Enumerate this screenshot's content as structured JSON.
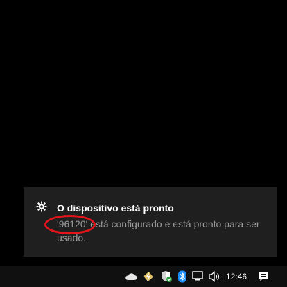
{
  "toast": {
    "icon": "gear-icon",
    "title": "O dispositivo está pronto",
    "body": "'96120' está configurado e está pronto para ser usado."
  },
  "annotation": {
    "shape": "ellipse",
    "color": "#e3141b",
    "target": "'96120'"
  },
  "taskbar": {
    "tray_icons": [
      "onedrive-cloud-icon",
      "power-battery-icon",
      "security-shield-icon",
      "bluetooth-icon",
      "network-icon",
      "volume-icon"
    ],
    "clock": "12:46",
    "action_center_icon": "notification-icon"
  },
  "colors": {
    "toast_bg": "#1f1f1f",
    "taskbar_bg": "#101010",
    "accent_bluetooth": "#1e90ff",
    "shield_green": "#2ea043"
  }
}
